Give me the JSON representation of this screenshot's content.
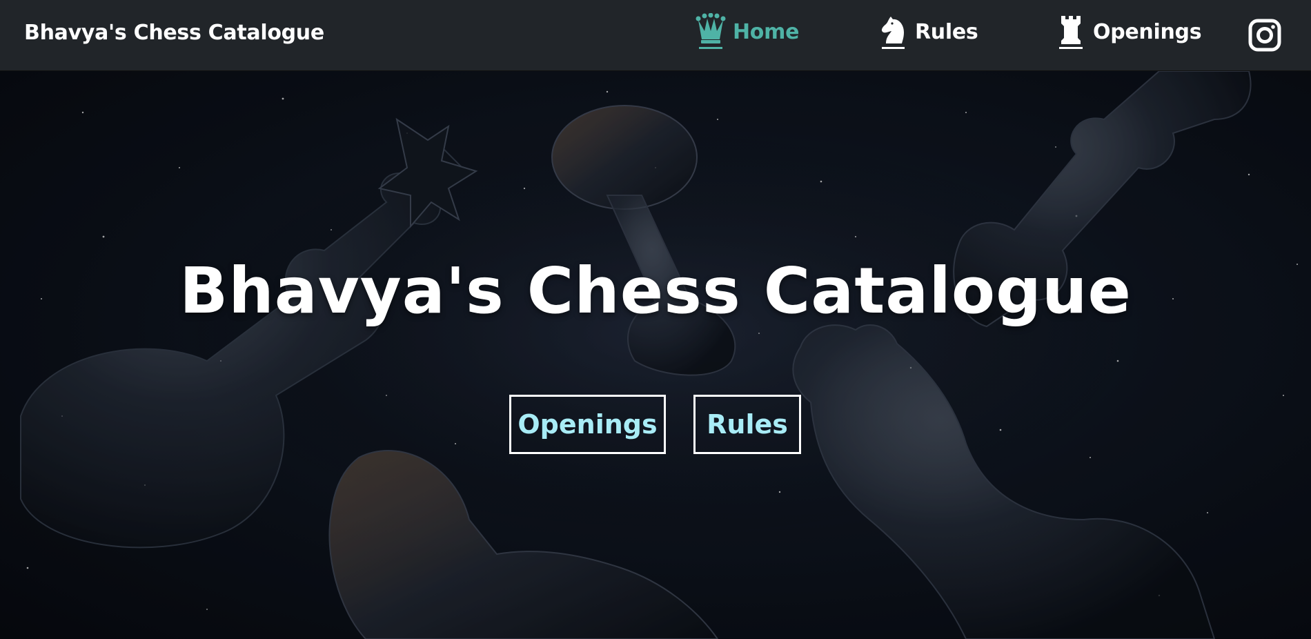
{
  "navbar": {
    "brand": "Bhavya's Chess Catalogue",
    "items": [
      {
        "label": "Home",
        "icon": "queen-icon",
        "active": true
      },
      {
        "label": "Rules",
        "icon": "knight-icon",
        "active": false
      },
      {
        "label": "Openings",
        "icon": "rook-icon",
        "active": false
      }
    ],
    "social_icon": "instagram-icon"
  },
  "hero": {
    "title": "Bhavya's Chess Catalogue",
    "buttons": [
      {
        "label": "Openings"
      },
      {
        "label": "Rules"
      }
    ],
    "background": "glass chess pieces floating in starry space"
  },
  "colors": {
    "navbar_bg": "#212529",
    "active_nav": "#4fb3a6",
    "button_text": "#a8ecf6",
    "button_border": "#ffffff",
    "text": "#ffffff"
  }
}
